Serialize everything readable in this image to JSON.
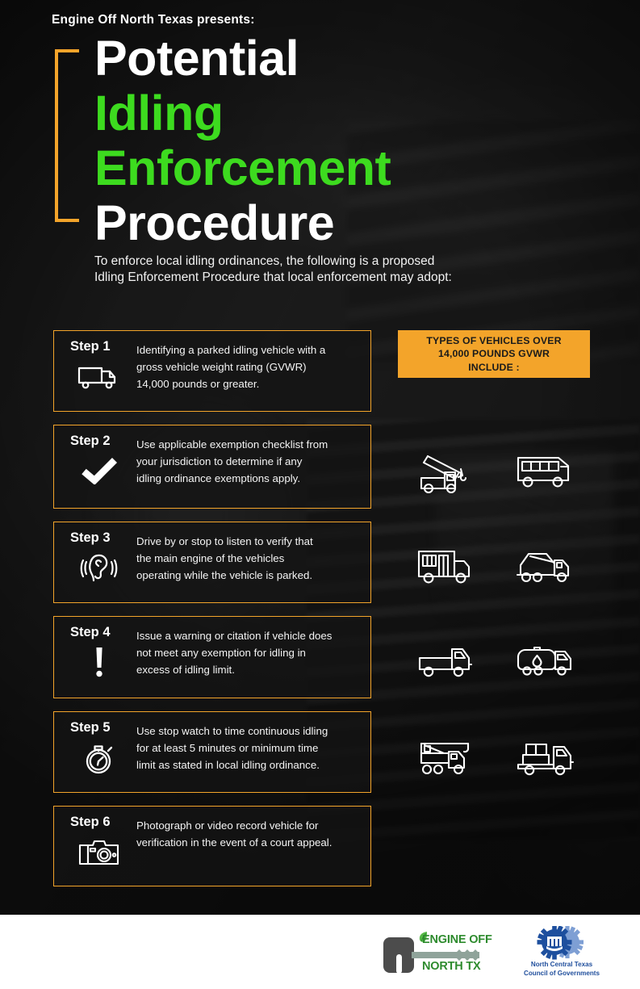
{
  "header": {
    "presents": "Engine Off North Texas presents:",
    "title_lines": [
      {
        "text": "Potential",
        "color": "white"
      },
      {
        "text": "Idling",
        "color": "green"
      },
      {
        "text": "Enforcement",
        "color": "green"
      },
      {
        "text": "Procedure",
        "color": "white"
      }
    ],
    "subtitle": "To enforce local idling ordinances, the following is a proposed\nIdling Enforcement Procedure that local enforcement may adopt:"
  },
  "steps": [
    {
      "label": "Step 1",
      "icon": "box-truck-icon",
      "text": "Identifying a parked idling vehicle with a\ngross vehicle weight rating (GVWR)\n14,000 pounds or greater."
    },
    {
      "label": "Step 2",
      "icon": "checkmark-icon",
      "text": "Use applicable exemption checklist from\nyour jurisdiction to determine if any\nidling ordinance exemptions apply."
    },
    {
      "label": "Step 3",
      "icon": "ear-listening-icon",
      "text": "Drive by or stop to listen to verify that\nthe main engine of the vehicles\noperating while the vehicle is parked."
    },
    {
      "label": "Step 4",
      "icon": "exclamation-icon",
      "text": "Issue a warning or citation if vehicle does\nnot meet any exemption for idling in\nexcess of idling limit."
    },
    {
      "label": "Step 5",
      "icon": "stopwatch-icon",
      "text": "Use stop watch to time continuous idling\nfor at least 5 minutes or minimum time\nlimit as stated in local idling ordinance."
    },
    {
      "label": "Step 6",
      "icon": "camera-icon",
      "text": "Photograph or video record vehicle for\nverification in the event of a court appeal."
    }
  ],
  "vehicles_panel": {
    "heading": "TYPES OF VEHICLES OVER\n14,000 POUNDS GVWR\nINCLUDE :",
    "icons": [
      "crane-truck-icon",
      "city-bus-icon",
      "school-bus-icon",
      "cement-mixer-truck-icon",
      "flatbed-truck-icon",
      "tanker-truck-icon",
      "mobile-crane-icon",
      "cargo-box-truck-icon"
    ]
  },
  "footer": {
    "engine_off_logo": {
      "line1": "ENGINE OFF",
      "line2": "NORTH TX",
      "icon": "key-icon",
      "leaf_icon": "leaf-icon"
    },
    "nctcog_logo": {
      "text": "North Central Texas\nCouncil of Governments",
      "icon": "gear-icon"
    }
  },
  "colors": {
    "accent_orange": "#F3A42A",
    "accent_green": "#3DDB1F",
    "background_dark": "#1D1D1D",
    "footer_white": "#FFFFFF",
    "logo_green": "#2E8B2E",
    "logo_blue": "#1F4E9C"
  }
}
